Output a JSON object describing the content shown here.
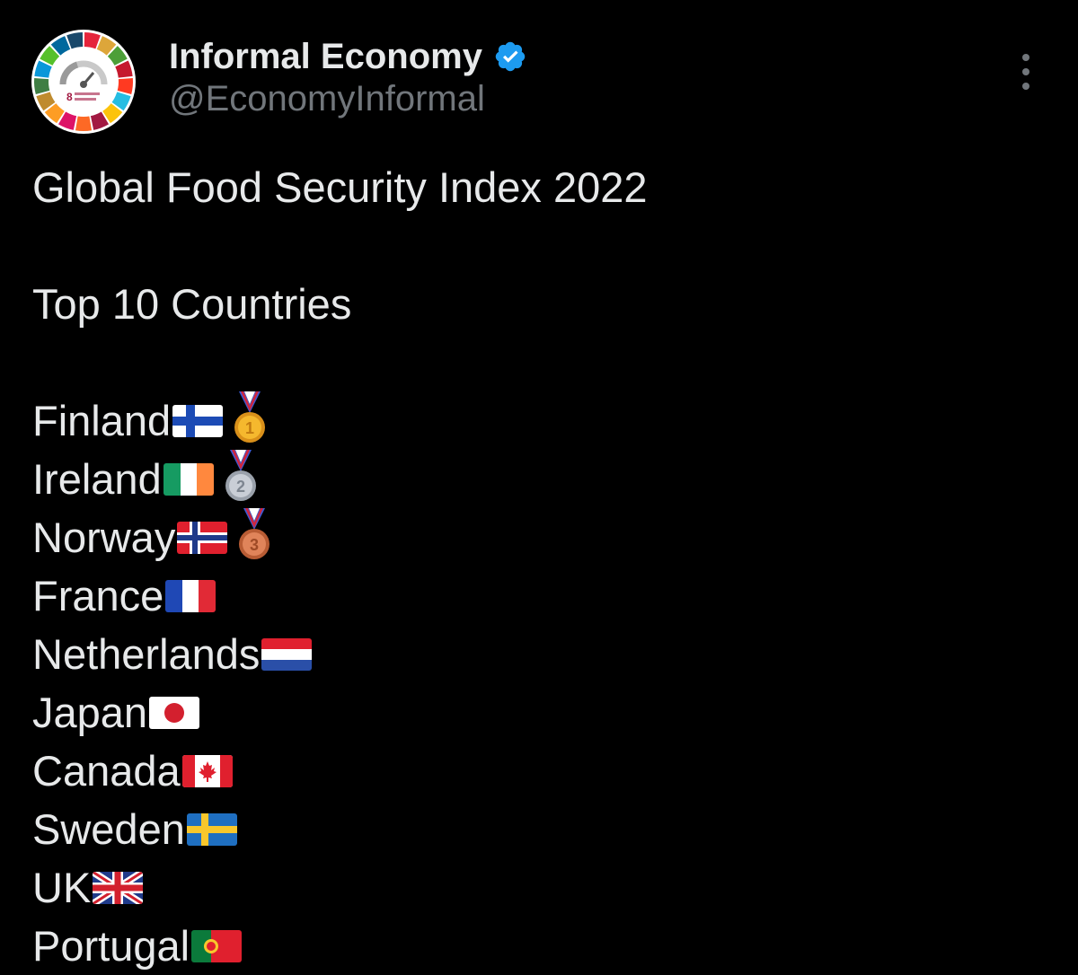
{
  "author": {
    "name": "Informal Economy",
    "handle": "@EconomyInformal",
    "verified": true,
    "avatar_icon": "sdg-wheel-avatar",
    "avatar_text": "8"
  },
  "colors": {
    "background": "#000000",
    "text": "#e7e9ea",
    "secondary_text": "#71767b",
    "verified_badge": "#1d9bf0"
  },
  "tweet": {
    "title": "Global Food Security Index 2022",
    "subtitle": "Top 10 Countries",
    "countries": [
      {
        "name": "Finland",
        "flag": "flag-finland",
        "medal": "gold",
        "medal_number": "1"
      },
      {
        "name": "Ireland",
        "flag": "flag-ireland",
        "medal": "silver",
        "medal_number": "2"
      },
      {
        "name": "Norway",
        "flag": "flag-norway",
        "medal": "bronze",
        "medal_number": "3"
      },
      {
        "name": "France",
        "flag": "flag-france"
      },
      {
        "name": "Netherlands",
        "flag": "flag-netherlands"
      },
      {
        "name": "Japan",
        "flag": "flag-japan"
      },
      {
        "name": "Canada",
        "flag": "flag-canada"
      },
      {
        "name": "Sweden",
        "flag": "flag-sweden"
      },
      {
        "name": "UK",
        "flag": "flag-uk"
      },
      {
        "name": "Portugal",
        "flag": "flag-portugal"
      }
    ]
  }
}
